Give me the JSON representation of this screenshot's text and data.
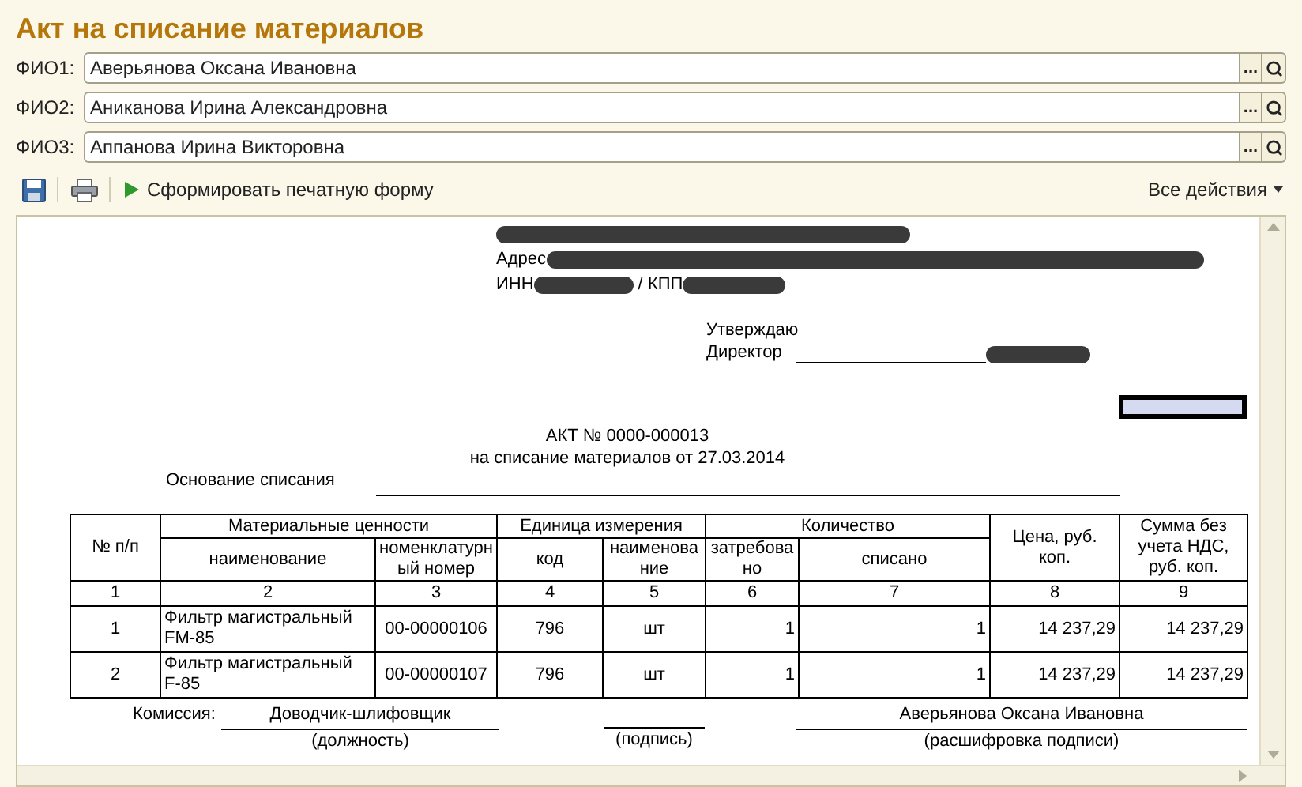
{
  "title": "Акт на списание материалов",
  "fields": [
    {
      "label": "ФИО1:",
      "value": "Аверьянова Оксана Ивановна",
      "select_button": "..."
    },
    {
      "label": "ФИО2:",
      "value": "Аниканова Ирина Александровна",
      "select_button": "..."
    },
    {
      "label": "ФИО3:",
      "value": "Аппанова Ирина Викторовна",
      "select_button": "..."
    }
  ],
  "toolbar": {
    "action": "Сформировать печатную форму",
    "all_actions": "Все действия"
  },
  "document": {
    "address_label": "Адрес",
    "inn_label": "ИНН",
    "kpp_label": "/ КПП",
    "approval": {
      "label": "Утверждаю",
      "position": "Директор"
    },
    "act_number": "АКТ № 0000-000013",
    "act_subtitle": "на списание материалов от 27.03.2014",
    "basis_label": "Основание списания",
    "table": {
      "headers": [
        {
          "label": "№ п/п"
        },
        {
          "label": "Материальные ценности",
          "children": [
            {
              "label": "наименование"
            },
            {
              "label": "номенклатурный номер"
            }
          ]
        },
        {
          "label": "Единица измерения",
          "children": [
            {
              "label": "код"
            },
            {
              "label": "наименование"
            }
          ]
        },
        {
          "label": "Количество",
          "children": [
            {
              "label": "затребовано"
            },
            {
              "label": "списано"
            }
          ]
        },
        {
          "label": "Цена, руб. коп."
        },
        {
          "label": "Сумма без учета НДС, руб. коп."
        }
      ],
      "column_numbers": [
        "1",
        "2",
        "3",
        "4",
        "5",
        "6",
        "7",
        "8",
        "9"
      ],
      "rows": [
        [
          "1",
          "Фильтр магистральный FM-85",
          "00-00000106",
          "796",
          "шт",
          "1",
          "1",
          "14 237,29",
          "14 237,29"
        ],
        [
          "2",
          "Фильтр магистральный F-85",
          "00-00000107",
          "796",
          "шт",
          "1",
          "1",
          "14 237,29",
          "14 237,29"
        ]
      ]
    },
    "commission": {
      "label": "Комиссия:",
      "position": "Доводчик-шлифовщик",
      "name": "Аверьянова Оксана Ивановна",
      "captions": [
        "(должность)",
        "(подпись)",
        "(расшифровка подписи)"
      ]
    }
  }
}
